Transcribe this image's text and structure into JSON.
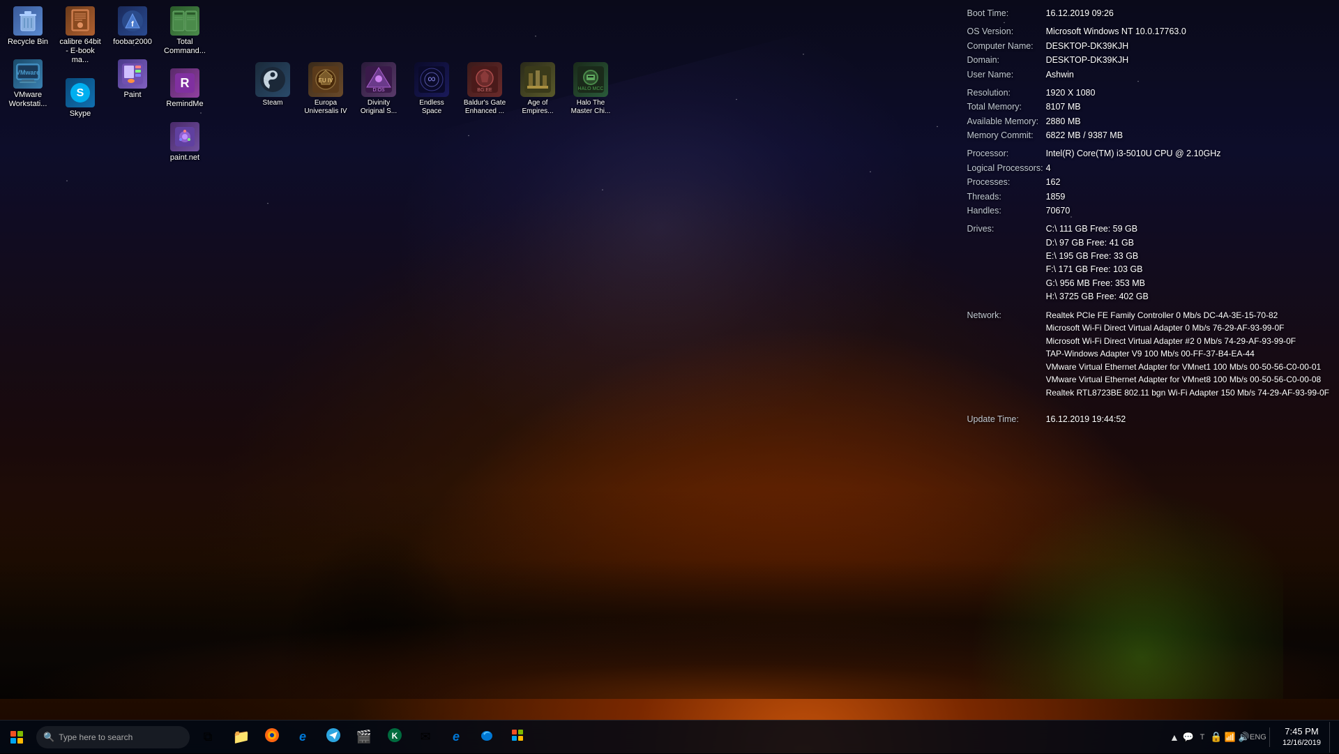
{
  "desktop": {
    "icons_col1": [
      {
        "id": "recycle-bin",
        "label": "Recycle Bin",
        "color1": "#3a5a9a",
        "color2": "#5a8ad0",
        "symbol": "🗑"
      },
      {
        "id": "vmware",
        "label": "VMware Workstati...",
        "color1": "#3a6a8a",
        "color2": "#5090b0",
        "symbol": "V"
      }
    ],
    "icons_col2": [
      {
        "id": "calibre",
        "label": "calibre 64bit - E-book ma...",
        "color1": "#6a3a1a",
        "color2": "#c07040",
        "symbol": "📚"
      },
      {
        "id": "skype",
        "label": "Skype",
        "color1": "#1a5a8a",
        "color2": "#2080c0",
        "symbol": "S"
      }
    ],
    "icons_col3": [
      {
        "id": "foobar",
        "label": "foobar2000",
        "color1": "#1a3a6a",
        "color2": "#3060a0",
        "symbol": "f"
      },
      {
        "id": "paint",
        "label": "Paint",
        "color1": "#6a3a8a",
        "color2": "#a060c0",
        "symbol": "🎨"
      }
    ],
    "icons_col4": [
      {
        "id": "totalcmd",
        "label": "Total Command...",
        "color1": "#2a5a2a",
        "color2": "#4a8a4a",
        "symbol": "TC"
      },
      {
        "id": "remindme",
        "label": "RemindMe",
        "color1": "#5a2a6a",
        "color2": "#9040a0",
        "symbol": "R"
      },
      {
        "id": "paintnet",
        "label": "paint.net",
        "color1": "#4a2a6a",
        "color2": "#7050a0",
        "symbol": "P"
      }
    ],
    "game_icons": [
      {
        "id": "steam",
        "label": "Steam",
        "color1": "#1a2a3a",
        "color2": "#2a4a6a",
        "symbol": "♨"
      },
      {
        "id": "europa",
        "label": "Europa Universalis IV",
        "color1": "#3a2a1a",
        "color2": "#6a4a2a",
        "symbol": "EU"
      },
      {
        "id": "divinity",
        "label": "Divinity Original S...",
        "color1": "#2a1a3a",
        "color2": "#5a3a6a",
        "symbol": "D"
      },
      {
        "id": "endless",
        "label": "Endless Space",
        "color1": "#1a1a3a",
        "color2": "#2a2a6a",
        "symbol": "∞"
      },
      {
        "id": "baldurs",
        "label": "Baldur's Gate Enhanced ...",
        "color1": "#3a1a1a",
        "color2": "#6a2a2a",
        "symbol": "BG"
      },
      {
        "id": "age",
        "label": "Age of Empires...",
        "color1": "#2a2a1a",
        "color2": "#5a5a2a",
        "symbol": "AE"
      },
      {
        "id": "halo",
        "label": "Halo The Master Chi...",
        "color1": "#1a2a1a",
        "color2": "#2a5a3a",
        "symbol": "H"
      }
    ]
  },
  "sysinfo": {
    "boot_time_label": "Boot Time:",
    "boot_time_value": "16.12.2019 09:26",
    "os_version_label": "OS Version:",
    "os_version_value": "Microsoft Windows NT 10.0.17763.0",
    "computer_name_label": "Computer Name:",
    "computer_name_value": "DESKTOP-DK39KJH",
    "domain_label": "Domain:",
    "domain_value": "DESKTOP-DK39KJH",
    "user_name_label": "User Name:",
    "user_name_value": "Ashwin",
    "resolution_label": "Resolution:",
    "resolution_value": "1920 X 1080",
    "total_memory_label": "Total Memory:",
    "total_memory_value": "8107 MB",
    "available_memory_label": "Available Memory:",
    "available_memory_value": "2880 MB",
    "memory_commit_label": "Memory Commit:",
    "memory_commit_value": "6822 MB / 9387 MB",
    "processor_label": "Processor:",
    "processor_value": "Intel(R) Core(TM) i3-5010U CPU @ 2.10GHz",
    "logical_processors_label": "Logical Processors:",
    "logical_processors_value": "4",
    "processes_label": "Processes:",
    "processes_value": "162",
    "threads_label": "Threads:",
    "threads_value": "1859",
    "handles_label": "Handles:",
    "handles_value": "70670",
    "drives_label": "Drives:",
    "drives": [
      "C:\\  111 GB Free:  59 GB",
      "D:\\  97 GB Free:  41 GB",
      "E:\\  195 GB Free:  33 GB",
      "F:\\  171 GB Free:  103 GB",
      "G:\\  956 MB Free:  353 MB",
      "H:\\  3725 GB Free:  402 GB"
    ],
    "network_label": "Network:",
    "network_entries": [
      "Realtek PCIe FE Family Controller 0 Mb/s DC-4A-3E-15-70-82",
      "Microsoft Wi-Fi Direct Virtual Adapter 0 Mb/s 76-29-AF-93-99-0F",
      "Microsoft Wi-Fi Direct Virtual Adapter #2 0 Mb/s 74-29-AF-93-99-0F",
      "TAP-Windows Adapter V9 100 Mb/s 00-FF-37-B4-EA-44",
      "VMware Virtual Ethernet Adapter for VMnet1 100 Mb/s 00-50-56-C0-00-01",
      "VMware Virtual Ethernet Adapter for VMnet8 100 Mb/s 00-50-56-C0-00-08",
      "Realtek RTL8723BE 802.11 bgn Wi-Fi Adapter 150 Mb/s 74-29-AF-93-99-0F"
    ],
    "update_time_label": "Update Time:",
    "update_time_value": "16.12.2019 19:44:52"
  },
  "taskbar": {
    "time": "7:45 PM",
    "date": "12/16/2019",
    "pinned_icons": [
      {
        "id": "start",
        "symbol": "⊞"
      },
      {
        "id": "search",
        "symbol": "🔍"
      },
      {
        "id": "taskview",
        "symbol": "❑"
      },
      {
        "id": "explorer",
        "symbol": "📁"
      },
      {
        "id": "firefox",
        "symbol": "🦊"
      },
      {
        "id": "ie",
        "symbol": "e"
      },
      {
        "id": "cortana",
        "symbol": "⊙"
      },
      {
        "id": "telegram",
        "symbol": "✈"
      },
      {
        "id": "media",
        "symbol": "🎬"
      },
      {
        "id": "kaspersky",
        "symbol": "K"
      },
      {
        "id": "mail",
        "symbol": "✉"
      },
      {
        "id": "edge",
        "symbol": "e"
      },
      {
        "id": "newedge",
        "symbol": "◎"
      },
      {
        "id": "store",
        "symbol": "🛍"
      }
    ],
    "tray_icons": [
      "▲",
      "💬",
      "T",
      "🔒",
      "📶",
      "🔊",
      "⌨"
    ],
    "show_desktop": "Show Desktop"
  }
}
